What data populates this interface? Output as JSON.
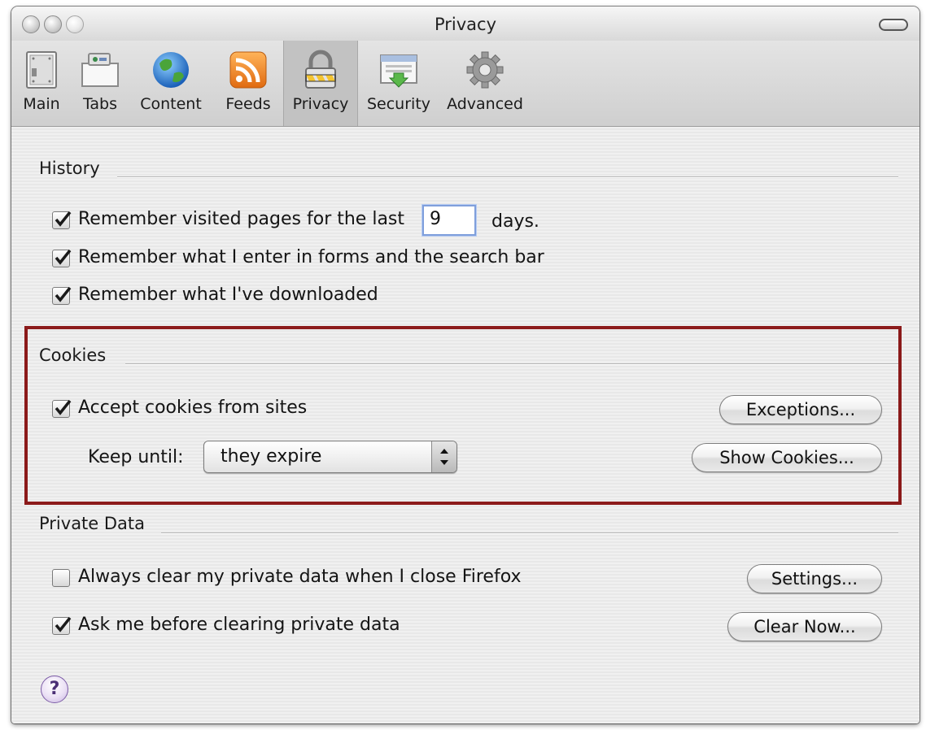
{
  "window": {
    "title": "Privacy"
  },
  "toolbar": {
    "items": [
      {
        "label": "Main",
        "icon": "main-switch-icon"
      },
      {
        "label": "Tabs",
        "icon": "tabs-icon"
      },
      {
        "label": "Content",
        "icon": "globe-icon"
      },
      {
        "label": "Feeds",
        "icon": "rss-icon"
      },
      {
        "label": "Privacy",
        "icon": "padlock-icon",
        "selected": true
      },
      {
        "label": "Security",
        "icon": "security-download-icon"
      },
      {
        "label": "Advanced",
        "icon": "gear-icon"
      }
    ]
  },
  "history": {
    "title": "History",
    "remember_visited_label": "Remember visited pages for the last",
    "remember_visited_checked": true,
    "days_value": "9",
    "days_label": "days.",
    "remember_forms_label": "Remember what I enter in forms and the search bar",
    "remember_forms_checked": true,
    "remember_downloads_label": "Remember what I've downloaded",
    "remember_downloads_checked": true
  },
  "cookies": {
    "title": "Cookies",
    "accept_label": "Accept cookies from sites",
    "accept_checked": true,
    "exceptions_button": "Exceptions...",
    "keep_until_label": "Keep until:",
    "keep_until_value": "they expire",
    "show_cookies_button": "Show Cookies..."
  },
  "private_data": {
    "title": "Private Data",
    "always_clear_label": "Always clear my private data when I close Firefox",
    "always_clear_checked": false,
    "settings_button": "Settings...",
    "ask_before_label": "Ask me before clearing private data",
    "ask_before_checked": true,
    "clear_now_button": "Clear Now..."
  },
  "help": {
    "glyph": "?"
  },
  "colors": {
    "highlight_border": "#8b1a1a",
    "text_field_focus": "#7f9fdc"
  }
}
